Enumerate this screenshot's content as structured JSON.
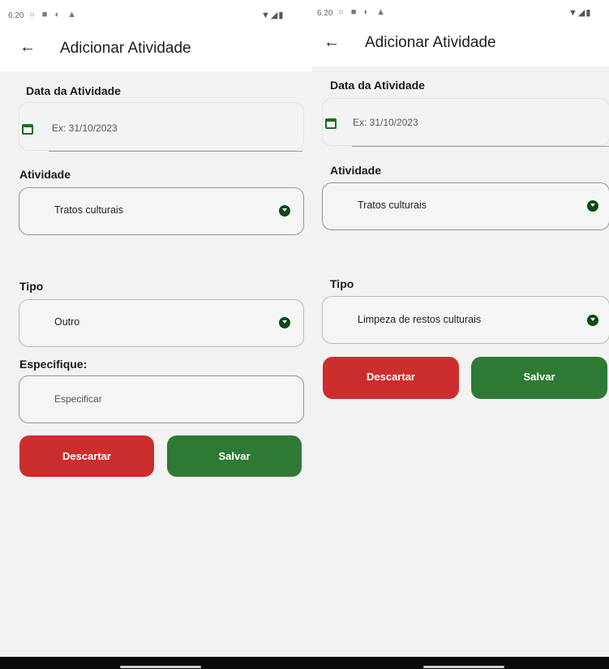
{
  "screens": [
    {
      "status": {
        "time": "6:20",
        "icons": "○ ■ ◐ ▲",
        "system": "▼◢▮"
      },
      "title": "Adicionar Atividade",
      "date": {
        "label": "Data da Atividade",
        "placeholder": "Ex: 31/10/2023"
      },
      "activity": {
        "label": "Atividade",
        "value": "Tratos culturais"
      },
      "type": {
        "label": "Tipo",
        "value": "Outro"
      },
      "specify": {
        "label": "Especifique:",
        "placeholder": "Especificar"
      },
      "buttons": {
        "discard": "Descartar",
        "save": "Salvar"
      }
    },
    {
      "status": {
        "time": "6:20",
        "icons": "○ ■ ◐ ▲",
        "system": "▼◢▮"
      },
      "title": "Adicionar Atividade",
      "date": {
        "label": "Data da Atividade",
        "placeholder": "Ex: 31/10/2023"
      },
      "activity": {
        "label": "Atividade",
        "value": "Tratos culturais"
      },
      "type": {
        "label": "Tipo",
        "value": "Limpeza de restos culturais"
      },
      "buttons": {
        "discard": "Descartar",
        "save": "Salvar"
      }
    }
  ],
  "colors": {
    "accent_green": "#2e7a34",
    "discard_red": "#cc2d2d",
    "dropdown_icon": "#0e4a11"
  }
}
